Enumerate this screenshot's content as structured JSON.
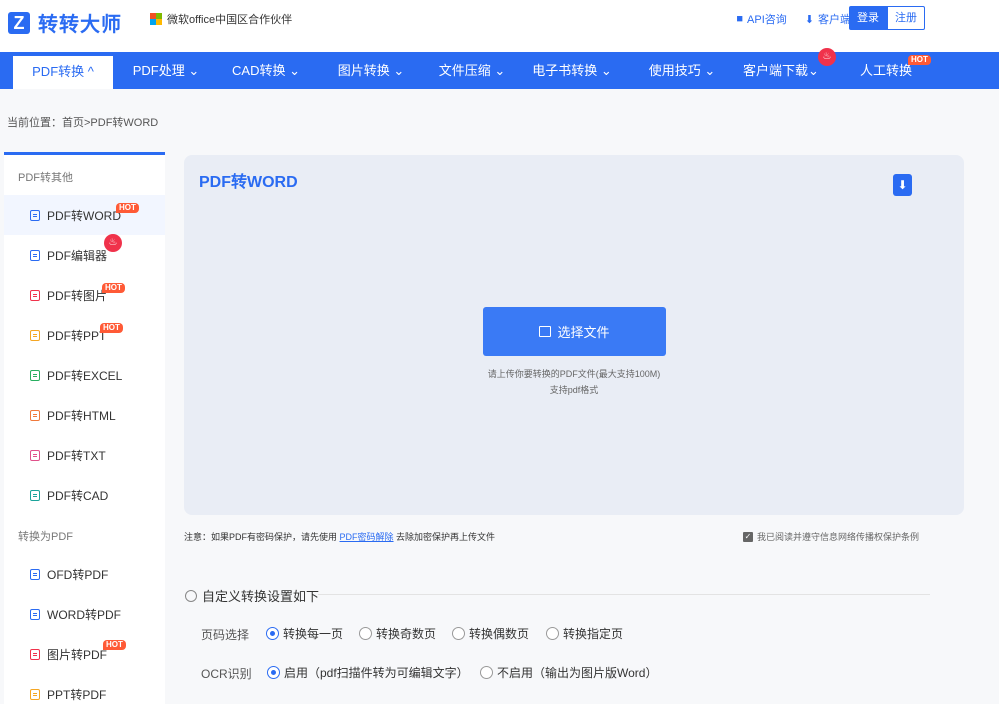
{
  "header": {
    "logo_mark": "Z",
    "logo_text": "转转大师",
    "partner_text": "微软office中国区合作伙伴",
    "api_label": "API咨询",
    "client_label": "客户端",
    "login_label": "登录",
    "register_label": "注册"
  },
  "nav": {
    "items": [
      {
        "label": "PDF转换 ^"
      },
      {
        "label": "PDF处理 ⌄"
      },
      {
        "label": "CAD转换 ⌄"
      },
      {
        "label": "图片转换 ⌄"
      },
      {
        "label": "文件压缩  ⌄"
      },
      {
        "label": "电子书转换 ⌄"
      },
      {
        "label": "使用技巧 ⌄"
      },
      {
        "label": "客户端下载⌄"
      },
      {
        "label": "人工转换"
      }
    ],
    "hot_badge": "HOT",
    "fire_icon": "flame-icon"
  },
  "breadcrumb": "当前位置：首页>PDF转WORD",
  "sidebar": {
    "group1": "PDF转其他",
    "group2": "转换为PDF",
    "items1": [
      {
        "label": "PDF转WORD"
      },
      {
        "label": "PDF编辑器"
      },
      {
        "label": "PDF转图片"
      },
      {
        "label": "PDF转PPT"
      },
      {
        "label": "PDF转EXCEL"
      },
      {
        "label": "PDF转HTML"
      },
      {
        "label": "PDF转TXT"
      },
      {
        "label": "PDF转CAD"
      }
    ],
    "items2": [
      {
        "label": "OFD转PDF"
      },
      {
        "label": "WORD转PDF"
      },
      {
        "label": "图片转PDF"
      },
      {
        "label": "PPT转PDF"
      }
    ],
    "hot_badge": "HOT"
  },
  "panel": {
    "title": "PDF转WORD",
    "select_label": "选择文件",
    "hint1": "请上传你要转换的PDF文件(最大支持100M)",
    "hint2": "支持pdf格式",
    "download_icon": "download-icon"
  },
  "notice": {
    "prefix": "注意：如果PDF有密码保护，请先使用 ",
    "link": "PDF密码解除",
    "suffix": " 去除加密保护再上传文件",
    "agree": "我已阅读并遵守信息网络传播权保护条例"
  },
  "settings": {
    "title": "自定义转换设置如下",
    "page_label": "页码选择",
    "page_options": [
      "转换每一页",
      "转换奇数页",
      "转换偶数页",
      "转换指定页"
    ],
    "ocr_label": "OCR识别",
    "ocr_options": [
      "启用（pdf扫描件转为可编辑文字）",
      "不启用（输出为图片版Word）"
    ]
  },
  "colors": {
    "accent": "#2a6bf2",
    "hot": "#ff5a36",
    "fire": "#f0324b"
  }
}
